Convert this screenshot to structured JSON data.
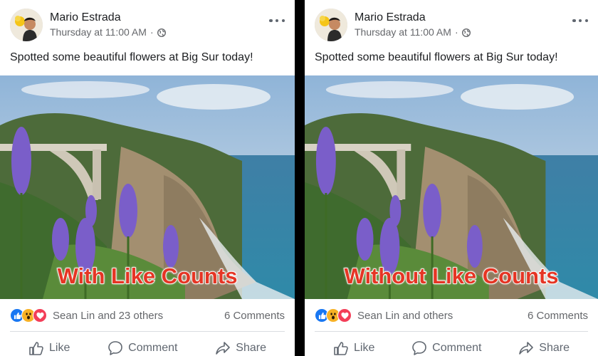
{
  "left_post": {
    "author": "Mario Estrada",
    "timestamp": "Thursday at 11:00 AM",
    "separator": "·",
    "text": "Spotted some beautiful flowers at Big Sur today!",
    "overlay_label": "With Like Counts",
    "reaction_summary": "Sean Lin and 23 others",
    "comments": "6 Comments",
    "actions": {
      "like": "Like",
      "comment": "Comment",
      "share": "Share"
    }
  },
  "right_post": {
    "author": "Mario Estrada",
    "timestamp": "Thursday at 11:00 AM",
    "separator": "·",
    "text": "Spotted some beautiful flowers at Big Sur today!",
    "overlay_label": "Without Like Counts",
    "reaction_summary": "Sean Lin and others",
    "comments": "6 Comments",
    "actions": {
      "like": "Like",
      "comment": "Comment",
      "share": "Share"
    }
  },
  "icons": {
    "privacy": "globe-icon",
    "menu": "more-options-icon",
    "reactions": [
      "like-reaction-icon",
      "wow-reaction-icon",
      "love-reaction-icon"
    ],
    "like": "thumbs-up-icon",
    "comment": "speech-bubble-icon",
    "share": "share-arrow-icon"
  },
  "colors": {
    "like_blue": "#1877f2",
    "love_red": "#f33e58",
    "wow_yellow": "#f7b125",
    "label_red": "#e53524",
    "secondary_text": "#65676b"
  }
}
